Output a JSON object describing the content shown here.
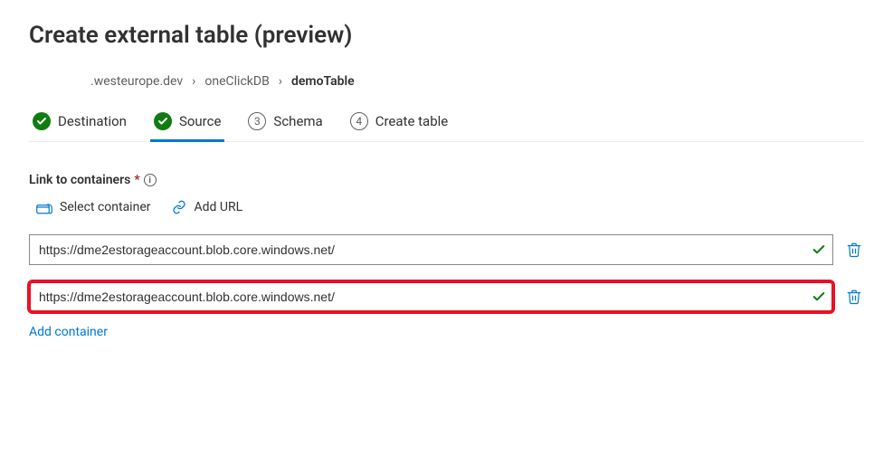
{
  "title": "Create external table (preview)",
  "breadcrumb": {
    "items": [
      {
        "label": ".westeurope.dev",
        "active": false
      },
      {
        "label": "oneClickDB",
        "active": false
      },
      {
        "label": "demoTable",
        "active": true
      }
    ]
  },
  "wizard": {
    "steps": [
      {
        "label": "Destination",
        "state": "done"
      },
      {
        "label": "Source",
        "state": "current"
      },
      {
        "num": "3",
        "label": "Schema",
        "state": "todo"
      },
      {
        "num": "4",
        "label": "Create table",
        "state": "todo"
      }
    ]
  },
  "source": {
    "section_label": "Link to containers",
    "required_marker": "*",
    "select_container_label": "Select container",
    "add_url_label": "Add URL",
    "urls": [
      {
        "value": "https://dme2estorageaccount.blob.core.windows.net/",
        "valid": true,
        "highlight": false
      },
      {
        "value": "https://dme2estorageaccount.blob.core.windows.net/",
        "valid": true,
        "highlight": true
      }
    ],
    "add_container_label": "Add container"
  }
}
